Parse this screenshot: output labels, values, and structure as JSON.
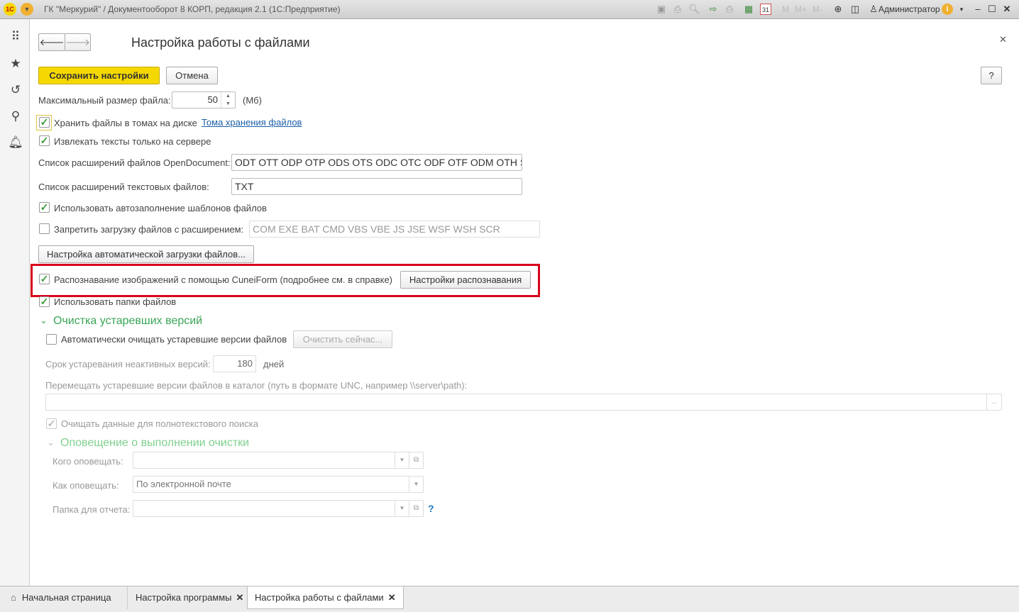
{
  "window": {
    "title": "ГК \"Меркурий\" / Документооборот 8 КОРП, редакция 2.1  (1С:Предприятие)",
    "user": "Администратор",
    "toolbar_icons": [
      "save-icon",
      "print-icon",
      "preview-icon",
      "export-icon",
      "print2-icon",
      "calculator-icon",
      "calendar-icon",
      "M",
      "M+",
      "M-",
      "zoom-icon",
      "panels-icon"
    ],
    "calendar_day": "31"
  },
  "sidebar": {
    "icons": [
      "apps-icon",
      "star-icon",
      "history-icon",
      "search-icon",
      "bell-icon"
    ]
  },
  "form": {
    "title": "Настройка работы с файлами",
    "save_label": "Сохранить настройки",
    "cancel_label": "Отмена",
    "help_label": "?",
    "max_size_label": "Максимальный размер файла:",
    "max_size_value": "50",
    "max_size_unit": "(Мб)",
    "store_volumes_label": "Хранить файлы в томах на диске",
    "store_volumes_link": "Тома хранения файлов",
    "store_volumes_checked": true,
    "extract_label": "Извлекать тексты только на сервере",
    "extract_checked": true,
    "opendoc_label": "Список расширений файлов OpenDocument:",
    "opendoc_value": "ODT OTT ODP OTP ODS OTS ODC OTC ODF OTF ODM OTH SDW",
    "text_ext_label": "Список расширений текстовых файлов:",
    "text_ext_value": "TXT",
    "autofill_label": "Использовать автозаполнение шаблонов файлов",
    "autofill_checked": true,
    "forbid_label": "Запретить загрузку файлов с расширением:",
    "forbid_checked": false,
    "forbid_value": "COM EXE BAT CMD VBS VBE JS JSE WSF WSH SCR",
    "auto_upload_button": "Настройка автоматической загрузки файлов...",
    "ocr_label": "Распознавание изображений с помощью CuneiForm (подробнее см. в справке)",
    "ocr_checked": true,
    "ocr_settings_button": "Настройки распознавания",
    "folders_label": "Использовать папки файлов",
    "folders_checked": true,
    "cleanup": {
      "title": "Очистка устаревших версий",
      "auto_label": "Автоматически очищать устаревшие версии файлов",
      "auto_checked": false,
      "clear_now": "Очистить сейчас...",
      "age_label": "Срок устаревания неактивных версий:",
      "age_value": "180",
      "age_unit": "дней",
      "move_label": "Перемещать устаревшие версии файлов в каталог (путь в формате UNC, например \\\\server\\path):",
      "move_value": "",
      "move_btn": "...",
      "fulltext_label": "Очищать данные для полнотекстового поиска",
      "fulltext_checked": true
    },
    "notify": {
      "title": "Оповещение о выполнении очистки",
      "whom_label": "Кого оповещать:",
      "whom_value": "",
      "how_label": "Как оповещать:",
      "how_value": "По электронной почте",
      "folder_label": "Папка для отчета:",
      "folder_value": "",
      "help": "?"
    }
  },
  "tabs": [
    {
      "label": "Начальная страница"
    },
    {
      "label": "Настройка программы"
    },
    {
      "label": "Настройка работы с файлами"
    }
  ],
  "colors": {
    "accent": "#3aa656",
    "highlight": "#d9001b",
    "save_button": "#f5d800",
    "link": "#1a5fa8"
  }
}
